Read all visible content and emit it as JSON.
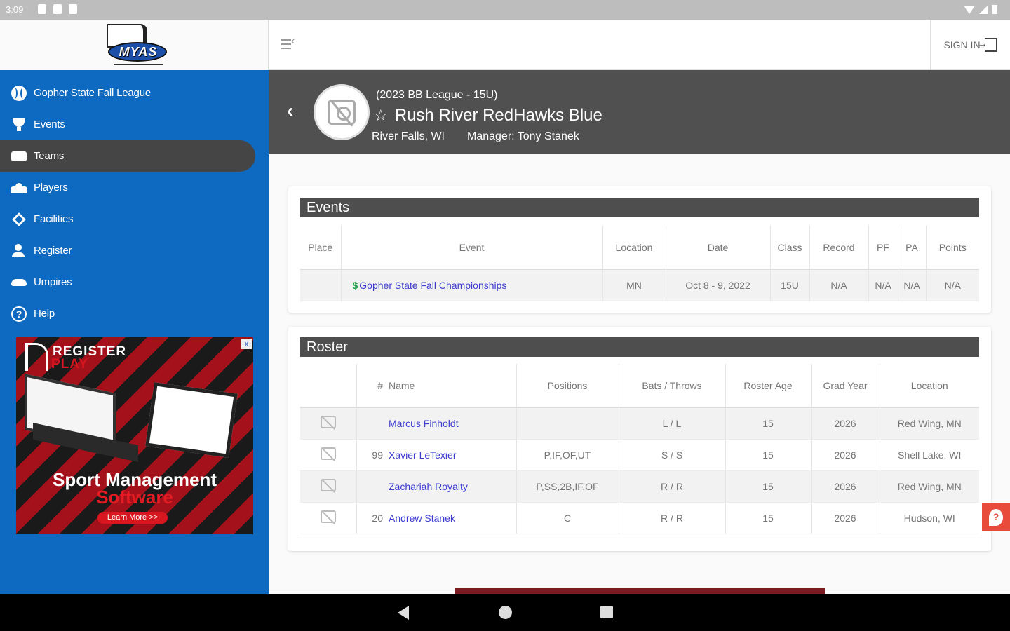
{
  "status_bar": {
    "time": "3:09"
  },
  "sidebar": {
    "logo_text": "MYAS",
    "items": [
      {
        "label": "Gopher State Fall League",
        "icon": "baseball-icon",
        "active": false
      },
      {
        "label": "Events",
        "icon": "trophy-icon",
        "active": false
      },
      {
        "label": "Teams",
        "icon": "teams-icon",
        "active": true
      },
      {
        "label": "Players",
        "icon": "players-icon",
        "active": false
      },
      {
        "label": "Facilities",
        "icon": "diamond-icon",
        "active": false
      },
      {
        "label": "Register",
        "icon": "register-icon",
        "active": false
      },
      {
        "label": "Umpires",
        "icon": "umpire-mask-icon",
        "active": false
      },
      {
        "label": "Help",
        "icon": "help-icon",
        "active": false
      }
    ],
    "ad": {
      "brand_line1": "REGISTER",
      "brand_line2": "PLAY",
      "title": "Sport Management",
      "subtitle": "Software",
      "button": "Learn More >>",
      "close": "x"
    }
  },
  "topbar": {
    "signin_label": "SIGN IN"
  },
  "team": {
    "league": "(2023 BB League - 15U)",
    "name": "Rush River RedHawks Blue",
    "location": "River Falls, WI",
    "manager_label": "Manager:",
    "manager": "Tony Stanek"
  },
  "events": {
    "title": "Events",
    "headers": [
      "Place",
      "Event",
      "Location",
      "Date",
      "Class",
      "Record",
      "PF",
      "PA",
      "Points"
    ],
    "rows": [
      {
        "place": "",
        "dollar": "$",
        "event": "Gopher State Fall Championships",
        "location": "MN",
        "date": "Oct 8 - 9, 2022",
        "class": "15U",
        "record": "N/A",
        "pf": "N/A",
        "pa": "N/A",
        "points": "N/A"
      }
    ]
  },
  "roster": {
    "title": "Roster",
    "headers": [
      "",
      "#",
      "Name",
      "Positions",
      "Bats / Throws",
      "Roster Age",
      "Grad Year",
      "Location"
    ],
    "rows": [
      {
        "num": "",
        "name": "Marcus Finholdt",
        "positions": "",
        "bats_throws": "L / L",
        "age": "15",
        "grad": "2026",
        "location": "Red Wing, MN"
      },
      {
        "num": "99",
        "name": "Xavier LeTexier",
        "positions": "P,IF,OF,UT",
        "bats_throws": "S / S",
        "age": "15",
        "grad": "2026",
        "location": "Shell Lake, WI"
      },
      {
        "num": "",
        "name": "Zachariah Royalty",
        "positions": "P,SS,2B,IF,OF",
        "bats_throws": "R / R",
        "age": "15",
        "grad": "2026",
        "location": "Red Wing, MN"
      },
      {
        "num": "20",
        "name": "Andrew Stanek",
        "positions": "C",
        "bats_throws": "R / R",
        "age": "15",
        "grad": "2026",
        "location": "Hudson, WI"
      }
    ]
  },
  "help_fab": "?",
  "colors": {
    "sidebar": "#0e6ac0",
    "header": "#505050",
    "link": "#3c3ccf",
    "accent": "#e84b39"
  }
}
